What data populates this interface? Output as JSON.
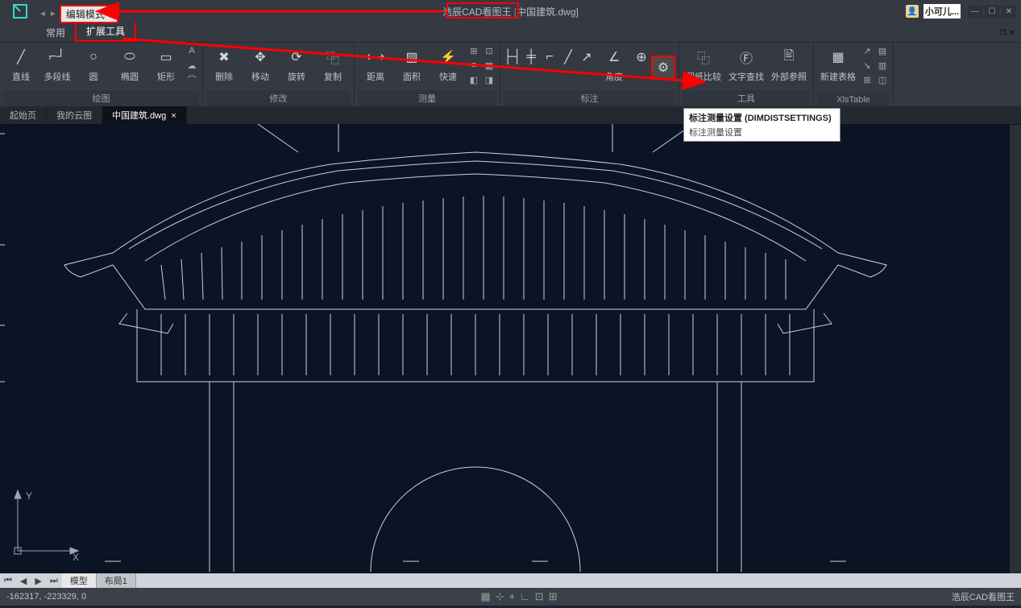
{
  "title_bar": {
    "app_name": "浩辰CAD看图王",
    "document": "中国建筑.dwg]",
    "user_name": "小可儿..."
  },
  "mode": {
    "label": "编辑模式"
  },
  "ribbon_tabs": {
    "common": "常用",
    "extended": "扩展工具"
  },
  "ribbon": {
    "groups": {
      "draw": "绘图",
      "modify": "修改",
      "measure": "测量",
      "annotate": "标注",
      "tools": "工具",
      "xlstable": "XlsTable"
    },
    "tools": {
      "line": "直线",
      "polyline": "多段线",
      "circle": "圆",
      "ellipse": "椭圆",
      "rectangle": "矩形",
      "text": "A",
      "delete": "删除",
      "move": "移动",
      "rotate": "旋转",
      "copy": "复制",
      "distance": "距离",
      "area": "面积",
      "fast": "快速",
      "angle": "角度",
      "compare": "图纸比较",
      "findtext": "文字查找",
      "xref": "外部参照",
      "newtable": "新建表格"
    }
  },
  "doc_tabs": {
    "start": "起始页",
    "mycloud": "我的云图",
    "current": "中国建筑.dwg"
  },
  "tooltip": {
    "title": "标注测量设置 (DIMDISTSETTINGS)",
    "body": "标注测量设置"
  },
  "layout_tabs": {
    "model": "模型",
    "layout1": "布局1"
  },
  "status": {
    "coords": "-162317, -223329, 0",
    "brand": "浩辰CAD看图王"
  },
  "axes": {
    "x": "X",
    "y": "Y"
  }
}
